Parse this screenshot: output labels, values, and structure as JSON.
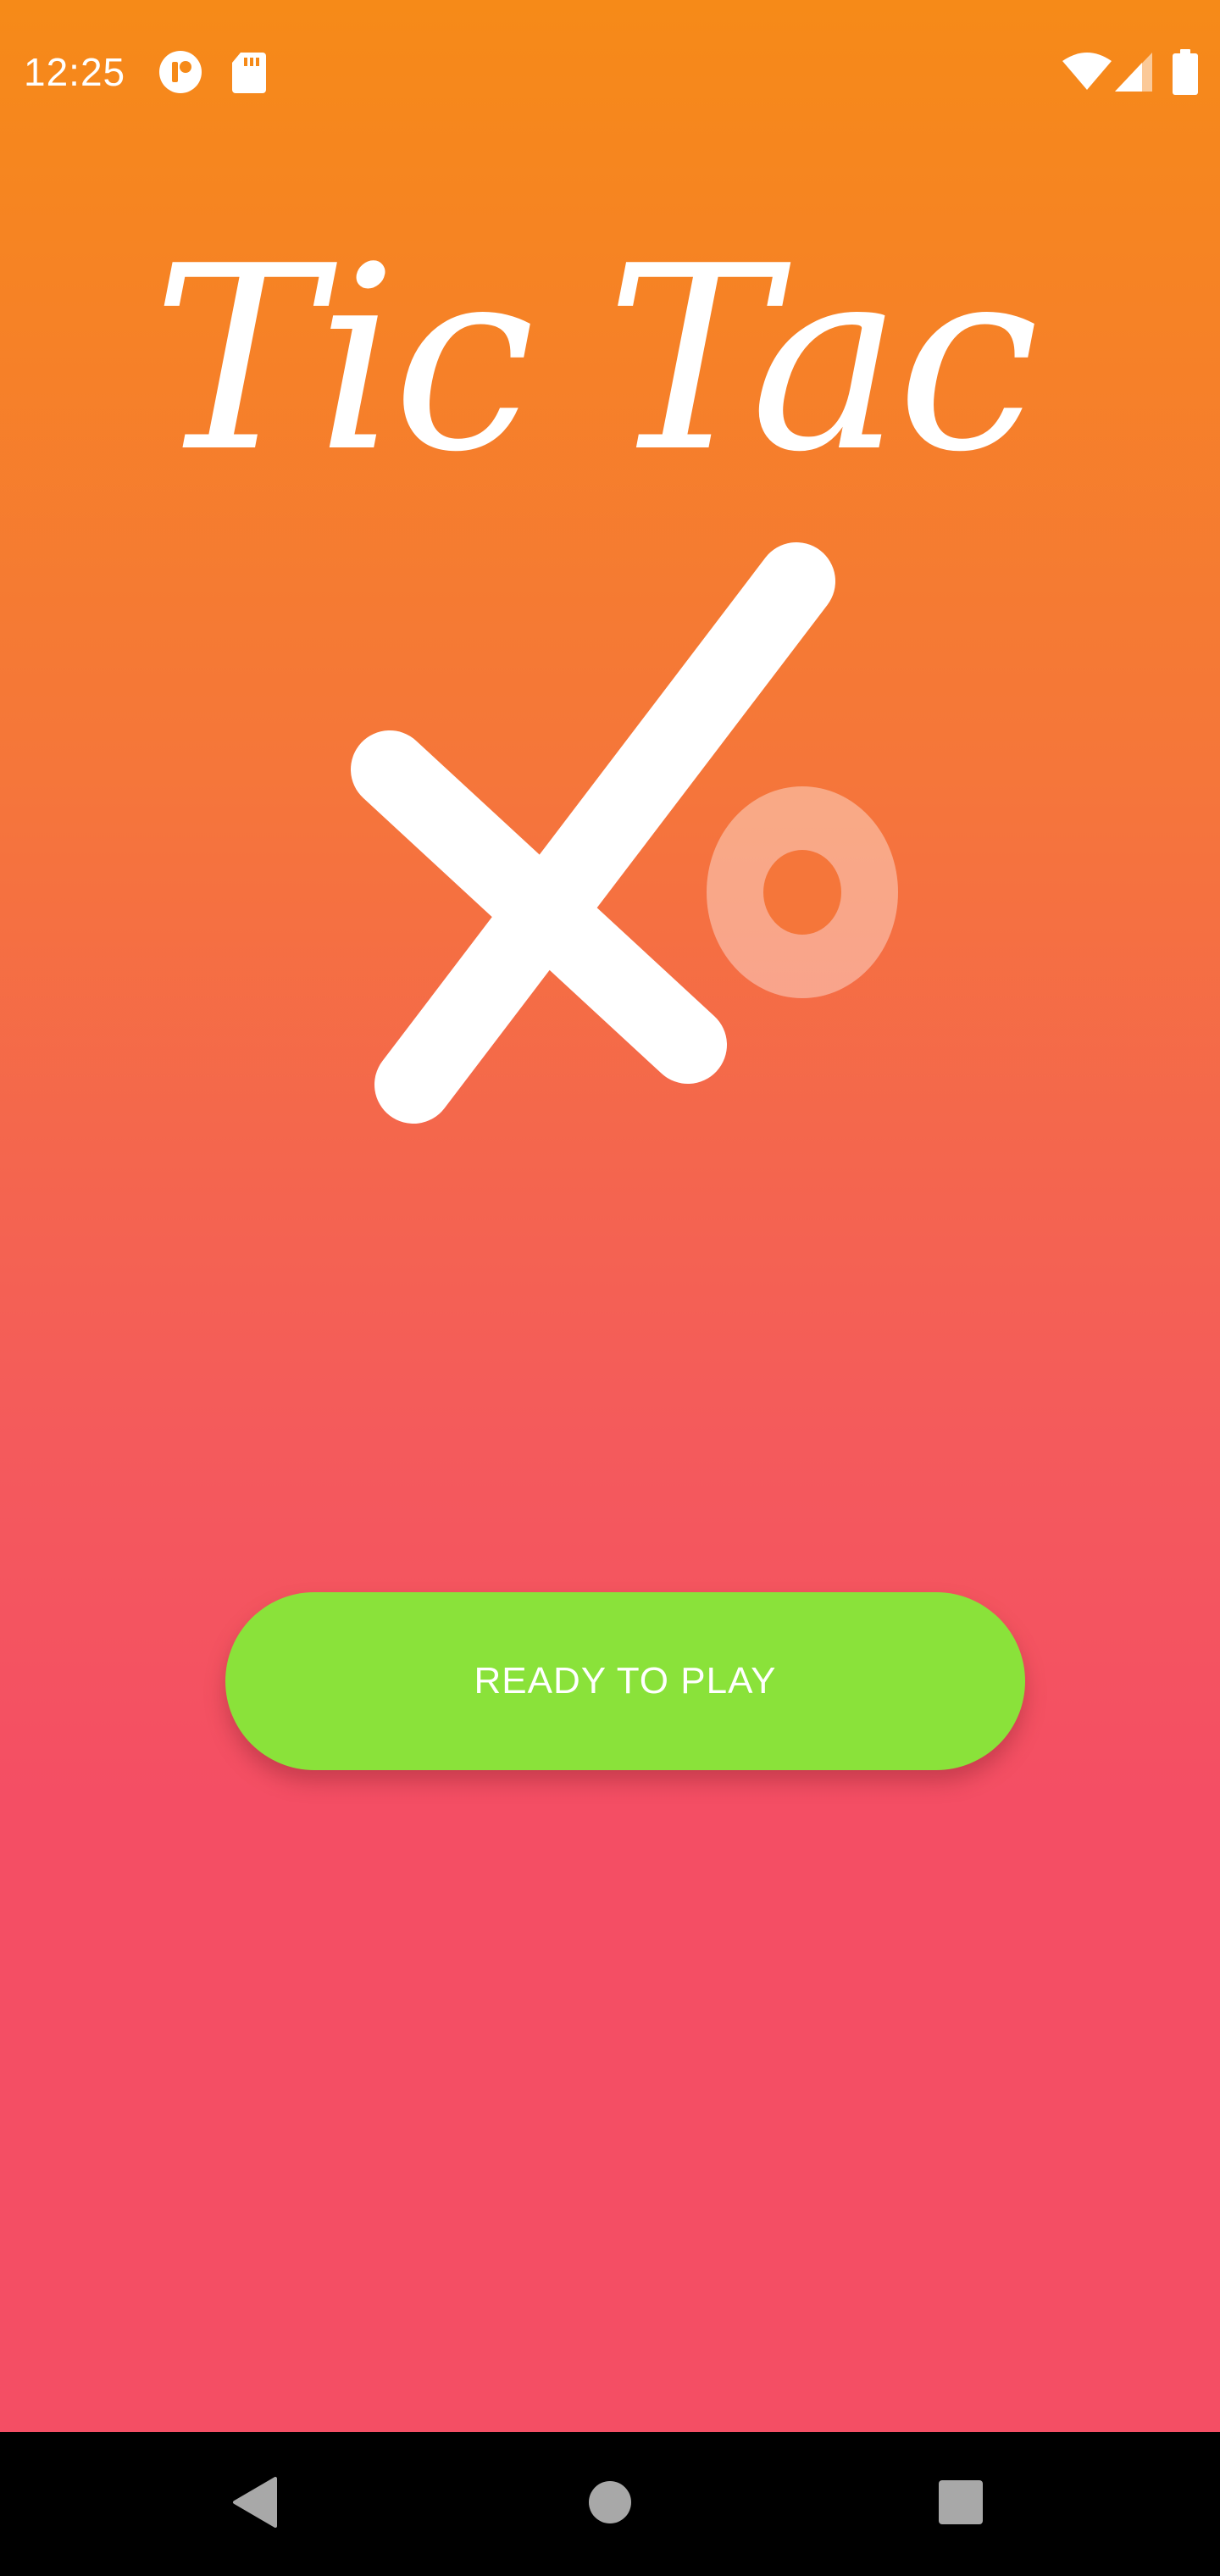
{
  "status_bar": {
    "time": "12:25",
    "icons": [
      "media-app-icon",
      "sd-card-icon",
      "wifi-icon",
      "cell-signal-icon",
      "battery-icon"
    ]
  },
  "app": {
    "title": "Tic Tac",
    "logo": "x-o-logo-icon"
  },
  "actions": {
    "play_label": "READY TO PLAY"
  },
  "nav_bar": {
    "buttons": [
      "back-icon",
      "home-icon",
      "recents-icon"
    ]
  },
  "colors": {
    "gradient_top": "#f68a18",
    "gradient_bottom": "#f44e64",
    "button": "#8ae23a",
    "nav_bar": "#000000",
    "text": "#ffffff"
  }
}
